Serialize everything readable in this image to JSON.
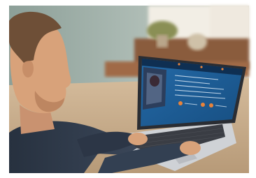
{
  "photo": {
    "subject": "person-using-laptop",
    "palette": {
      "page_bg": "#ffffff",
      "wall": "#9fb0a9",
      "window_light": "#f1ede4",
      "shelf": "#8a5b3c",
      "desk": "#c7ab8a",
      "hair": "#6e4f37",
      "skin": "#d8a27a",
      "sweater": "#2f3a4a",
      "laptop_body": "#c9ccd1",
      "screen_bg": "#1f5f9a",
      "screen_panel": "#123e68",
      "accent_orange": "#e8833a"
    }
  }
}
